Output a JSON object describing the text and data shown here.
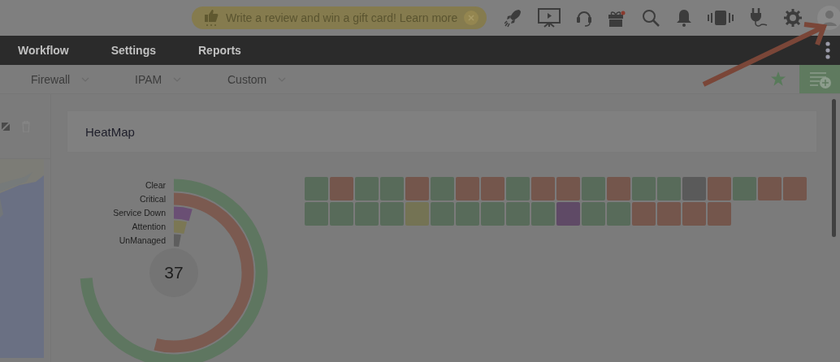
{
  "promo_banner": {
    "text": "Write a review and win a gift card! Learn more"
  },
  "nav": {
    "items": [
      {
        "label": "Workflow"
      },
      {
        "label": "Settings"
      },
      {
        "label": "Reports"
      }
    ]
  },
  "subnav": {
    "items": [
      {
        "label": "Firewall"
      },
      {
        "label": "IPAM"
      },
      {
        "label": "Custom"
      }
    ]
  },
  "heatmap": {
    "title": "HeatMap",
    "total": "37",
    "legend": [
      {
        "label": "Clear",
        "color": "#5e7660"
      },
      {
        "label": "Critical",
        "color": "#7b5a50"
      },
      {
        "label": "Service Down",
        "color": "#6a4f74"
      },
      {
        "label": "Attention",
        "color": "#7b7754"
      },
      {
        "label": "UnManaged",
        "color": "#5e5e5e"
      }
    ],
    "cells": [
      {
        "color": "#586b5a"
      },
      {
        "color": "#74564c"
      },
      {
        "color": "#586b5a"
      },
      {
        "color": "#586b5a"
      },
      {
        "color": "#74564c"
      },
      {
        "color": "#586b5a"
      },
      {
        "color": "#74564c"
      },
      {
        "color": "#74564c"
      },
      {
        "color": "#586b5a"
      },
      {
        "color": "#74564c"
      },
      {
        "color": "#74564c"
      },
      {
        "color": "#586b5a"
      },
      {
        "color": "#74564c"
      },
      {
        "color": "#586b5a"
      },
      {
        "color": "#586b5a"
      },
      {
        "color": "#5a5a5a"
      },
      {
        "color": "#74564c"
      },
      {
        "color": "#586b5a"
      },
      {
        "color": "#74564c"
      },
      {
        "color": "#74564c"
      },
      {
        "color": "#586b5a"
      },
      {
        "color": "#586b5a"
      },
      {
        "color": "#586b5a"
      },
      {
        "color": "#586b5a"
      },
      {
        "color": "#747354"
      },
      {
        "color": "#586b5a"
      },
      {
        "color": "#586b5a"
      },
      {
        "color": "#586b5a"
      },
      {
        "color": "#586b5a"
      },
      {
        "color": "#586b5a"
      },
      {
        "color": "#5f4a66"
      },
      {
        "color": "#586b5a"
      },
      {
        "color": "#586b5a"
      },
      {
        "color": "#74564c"
      },
      {
        "color": "#74564c"
      },
      {
        "color": "#74564c"
      },
      {
        "color": "#74564c"
      }
    ]
  }
}
